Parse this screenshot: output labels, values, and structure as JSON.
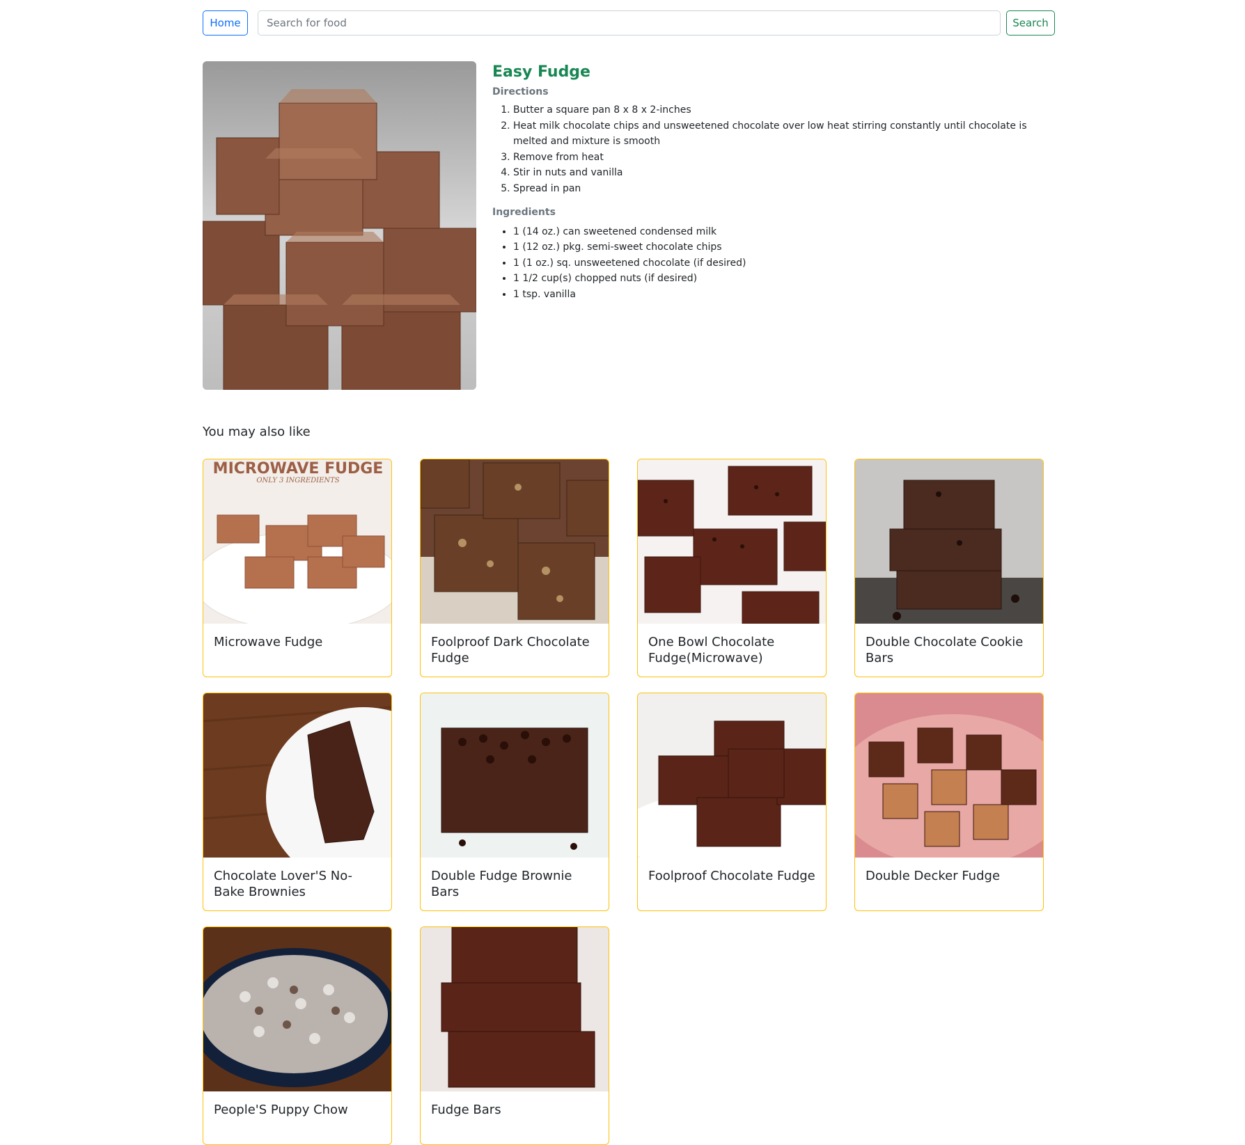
{
  "topbar": {
    "home_label": "Home",
    "search_placeholder": "Search for food",
    "search_label": "Search"
  },
  "recipe": {
    "title": "Easy Fudge",
    "directions_label": "Directions",
    "directions": [
      "Butter a square pan 8 x 8 x 2-inches",
      "Heat milk chocolate chips and unsweetened chocolate over low heat stirring constantly until chocolate is melted and mixture is smooth",
      "Remove from heat",
      "Stir in nuts and vanilla",
      "Spread in pan"
    ],
    "ingredients_label": "Ingredients",
    "ingredients": [
      "1 (14 oz.) can sweetened condensed milk",
      "1 (12 oz.) pkg. semi-sweet chocolate chips",
      "1 (1 oz.) sq. unsweetened chocolate (if desired)",
      "1 1/2 cup(s) chopped nuts (if desired)",
      "1 tsp. vanilla"
    ]
  },
  "related": {
    "heading": "You may also like",
    "items": [
      {
        "title": "Microwave Fudge",
        "banner": "MICROWAVE FUDGE",
        "banner_sub": "ONLY 3 INGREDIENTS"
      },
      {
        "title": "Foolproof Dark Chocolate Fudge"
      },
      {
        "title": "One Bowl Chocolate Fudge(Microwave)"
      },
      {
        "title": "Double Chocolate Cookie Bars"
      },
      {
        "title": "Chocolate Lover'S No-Bake Brownies"
      },
      {
        "title": "Double Fudge Brownie Bars"
      },
      {
        "title": "Foolproof Chocolate Fudge"
      },
      {
        "title": "Double Decker Fudge"
      },
      {
        "title": "People'S Puppy Chow"
      },
      {
        "title": "Fudge Bars"
      }
    ]
  },
  "colors": {
    "home_button": "#0d6efd",
    "search_button": "#198754",
    "recipe_title": "#198754",
    "card_border": "#ffc107",
    "section_label": "#6c757d"
  }
}
